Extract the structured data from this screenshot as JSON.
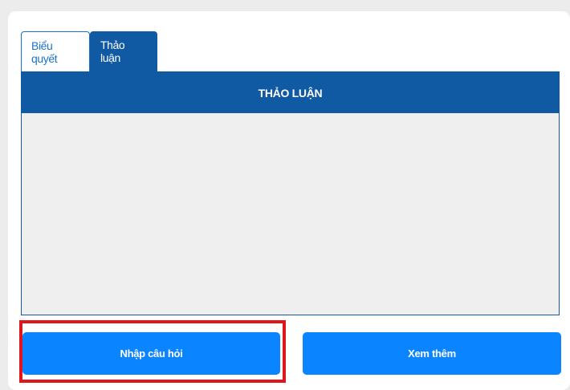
{
  "tabs": [
    {
      "label": "Biểu quyết",
      "active": false
    },
    {
      "label": "Thảo luận",
      "active": true
    }
  ],
  "panel": {
    "title": "THẢO LUẬN"
  },
  "actions": {
    "ask_label": "Nhập câu hỏi",
    "more_label": "Xem thêm"
  },
  "colors": {
    "primary_dark": "#0f5aa2",
    "button_blue": "#0a84ff",
    "highlight_red": "#e0161e",
    "panel_bg": "#efefef"
  }
}
